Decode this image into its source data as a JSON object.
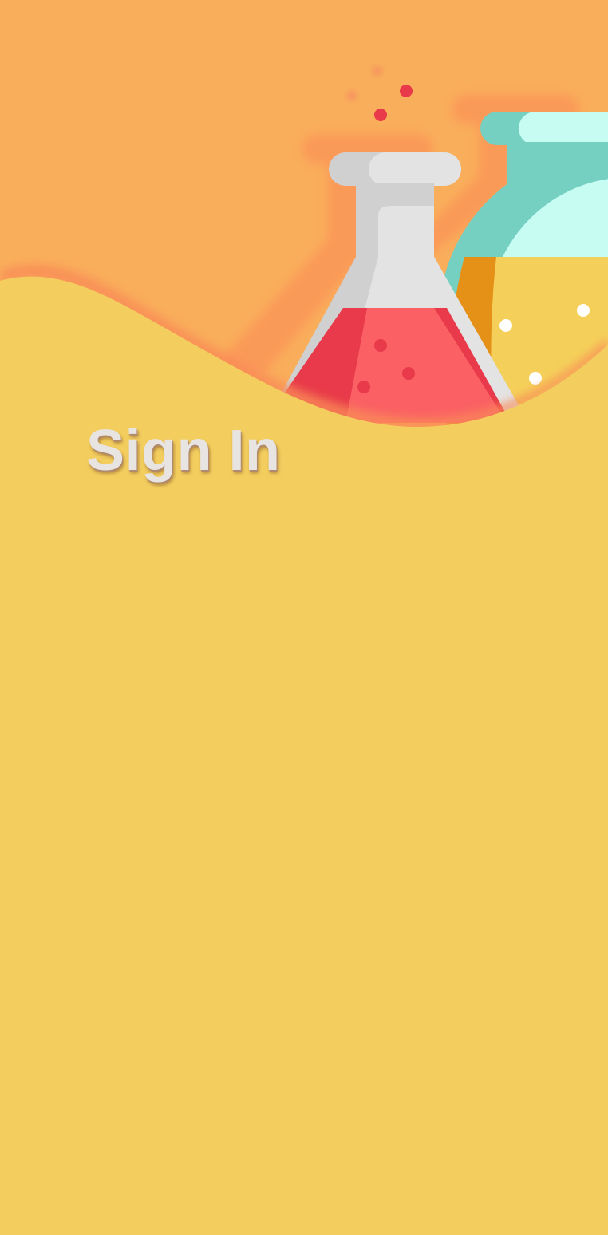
{
  "screen": {
    "title": "Sign In",
    "background_color": "#F3CE5E",
    "header_color": "#F9AE5B"
  },
  "illustration": {
    "name": "chemistry-flasks",
    "flask_color": "#E2E2E2",
    "liquid_color": "#FA6064",
    "bottle_color": "#C6FCF2",
    "bottle_liquid_color": "#F4D05A"
  }
}
